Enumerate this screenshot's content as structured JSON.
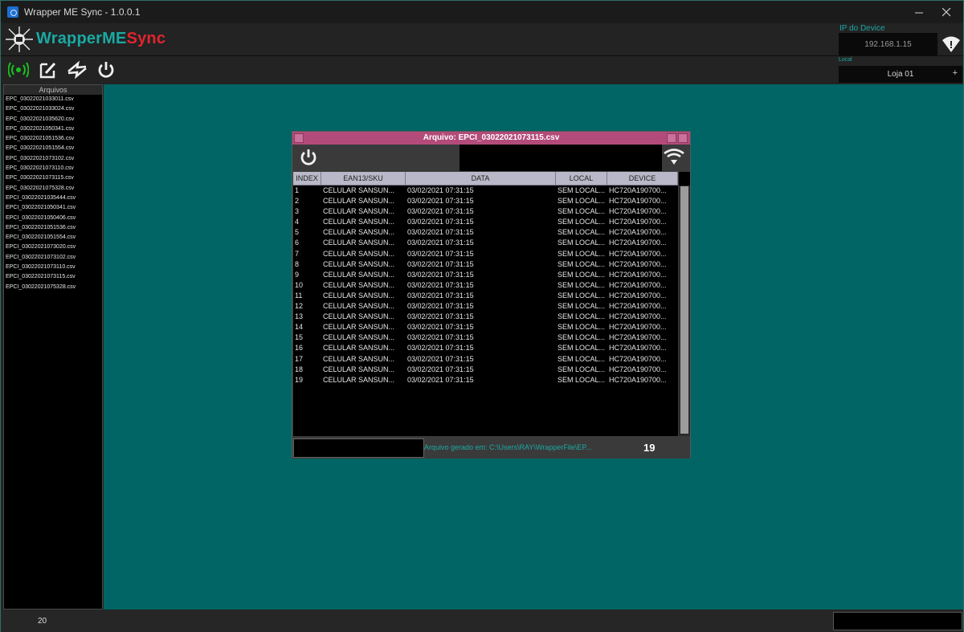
{
  "window": {
    "title": "Wrapper ME Sync - 1.0.0.1"
  },
  "header": {
    "logo_part1": "WrapperME",
    "logo_part2": "Sync",
    "ip_label": "IP do Device",
    "ip_value": "192.168.1.15"
  },
  "toolbar": {
    "local_label": "Local",
    "local_value": "Loja 01",
    "local_add": "+"
  },
  "sidebar": {
    "title": "Arquivos",
    "files": [
      "EPC_03022021033011.csv",
      "EPC_03022021033024.csv",
      "EPC_03022021035620.csv",
      "EPC_03022021050341.csv",
      "EPC_03022021051536.csv",
      "EPC_03022021051554.csv",
      "EPC_03022021073102.csv",
      "EPC_03022021073110.csv",
      "EPC_03022021073115.csv",
      "EPC_03022021075328.csv",
      "EPCI_03022021035444.csv",
      "EPCI_03022021050341.csv",
      "EPCI_03022021050406.csv",
      "EPCI_03022021051536.csv",
      "EPCI_03022021051554.csv",
      "EPCI_03022021073020.csv",
      "EPCI_03022021073102.csv",
      "EPCI_03022021073110.csv",
      "EPCI_03022021073115.csv",
      "EPCI_03022021075328.csv"
    ]
  },
  "file_window": {
    "title": "Arquivo: EPCI_03022021073115.csv",
    "columns": [
      "INDEX",
      "EAN13/SKU",
      "DATA",
      "LOCAL",
      "DEVICE"
    ],
    "rows": [
      [
        "1",
        "CELULAR SANSUN...",
        "03/02/2021 07:31:15",
        "SEM LOCAL...",
        "HC720A190700..."
      ],
      [
        "2",
        "CELULAR SANSUN...",
        "03/02/2021 07:31:15",
        "SEM LOCAL...",
        "HC720A190700..."
      ],
      [
        "3",
        "CELULAR SANSUN...",
        "03/02/2021 07:31:15",
        "SEM LOCAL...",
        "HC720A190700..."
      ],
      [
        "4",
        "CELULAR SANSUN...",
        "03/02/2021 07:31:15",
        "SEM LOCAL...",
        "HC720A190700..."
      ],
      [
        "5",
        "CELULAR SANSUN...",
        "03/02/2021 07:31:15",
        "SEM LOCAL...",
        "HC720A190700..."
      ],
      [
        "6",
        "CELULAR SANSUN...",
        "03/02/2021 07:31:15",
        "SEM LOCAL...",
        "HC720A190700..."
      ],
      [
        "7",
        "CELULAR SANSUN...",
        "03/02/2021 07:31:15",
        "SEM LOCAL...",
        "HC720A190700..."
      ],
      [
        "8",
        "CELULAR SANSUN...",
        "03/02/2021 07:31:15",
        "SEM LOCAL...",
        "HC720A190700..."
      ],
      [
        "9",
        "CELULAR SANSUN...",
        "03/02/2021 07:31:15",
        "SEM LOCAL...",
        "HC720A190700..."
      ],
      [
        "10",
        "CELULAR SANSUN...",
        "03/02/2021 07:31:15",
        "SEM LOCAL...",
        "HC720A190700..."
      ],
      [
        "11",
        "CELULAR SANSUN...",
        "03/02/2021 07:31:15",
        "SEM LOCAL...",
        "HC720A190700..."
      ],
      [
        "12",
        "CELULAR SANSUN...",
        "03/02/2021 07:31:15",
        "SEM LOCAL...",
        "HC720A190700..."
      ],
      [
        "13",
        "CELULAR SANSUN...",
        "03/02/2021 07:31:15",
        "SEM LOCAL...",
        "HC720A190700..."
      ],
      [
        "14",
        "CELULAR SANSUN...",
        "03/02/2021 07:31:15",
        "SEM LOCAL...",
        "HC720A190700..."
      ],
      [
        "15",
        "CELULAR SANSUN...",
        "03/02/2021 07:31:15",
        "SEM LOCAL...",
        "HC720A190700..."
      ],
      [
        "16",
        "CELULAR SANSUN...",
        "03/02/2021 07:31:15",
        "SEM LOCAL...",
        "HC720A190700..."
      ],
      [
        "17",
        "CELULAR SANSUN...",
        "03/02/2021 07:31:15",
        "SEM LOCAL...",
        "HC720A190700..."
      ],
      [
        "18",
        "CELULAR SANSUN...",
        "03/02/2021 07:31:15",
        "SEM LOCAL...",
        "HC720A190700..."
      ],
      [
        "19",
        "CELULAR SANSUN...",
        "03/02/2021 07:31:15",
        "SEM LOCAL...",
        "HC720A190700..."
      ]
    ],
    "status_text": "Arquivo gerado em: C:\\Users\\RAY\\WrapperFile\\EP...",
    "count": "19"
  },
  "statusbar": {
    "count": "20"
  },
  "colors": {
    "accent_teal": "#1aa9a3",
    "brand_red": "#e0252e",
    "workspace": "#006564",
    "frame_title": "#b34b7a",
    "signal_green": "#18c020"
  },
  "icons": {
    "toolbar": [
      "signal-icon",
      "edit-icon",
      "sync-icon",
      "power-icon"
    ],
    "header": [
      "wifi-icon"
    ]
  }
}
